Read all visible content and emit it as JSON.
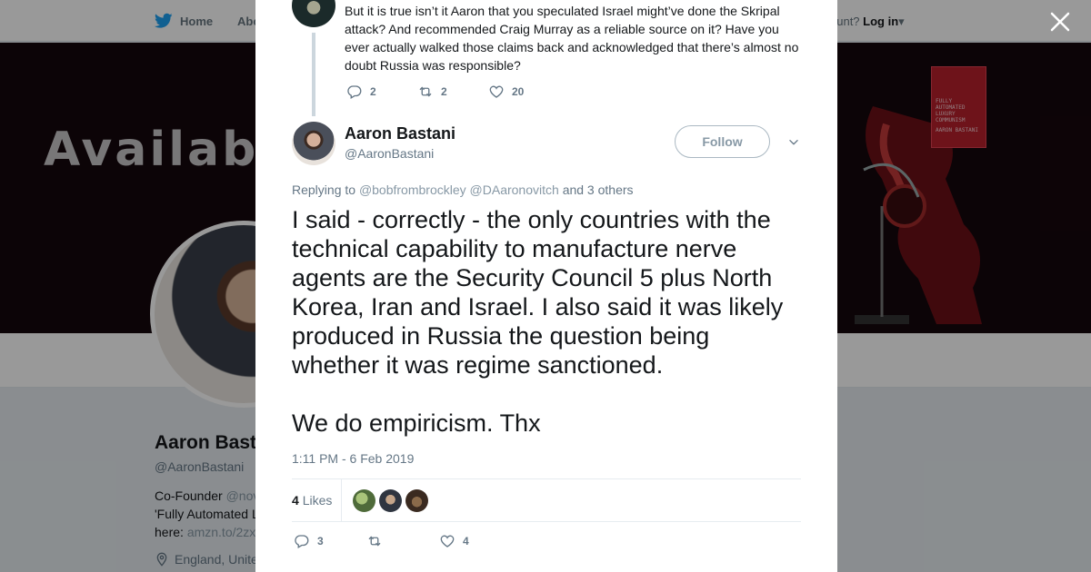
{
  "nav": {
    "home_label": "Home",
    "about_label": "Abo",
    "account_prompt": "ccount?",
    "login_label": "Log in"
  },
  "banner": {
    "text": "Availabl",
    "book_title": "FULLY AUTOMATED LUXURY COMMUNISM",
    "book_author": "AARON BASTANI"
  },
  "profile": {
    "name": "Aaron Bast",
    "handle": "@AaronBastani",
    "bio_line1": "Co-Founder",
    "bio_line1_link": "@nov",
    "bio_line2": "'Fully Automated L",
    "bio_line3": "here:",
    "bio_line3_link": "amzn.to/2zx",
    "location": "England, Unite"
  },
  "parent_tweet": {
    "text": "But it is true isn’t it Aaron that you speculated Israel might’ve done the Skripal attack? And recommended Craig Murray as a reliable source on it? Have you ever actually walked those claims back and acknowledged that there’s almost no doubt Russia was responsible?",
    "replies": "2",
    "retweets": "2",
    "likes": "20"
  },
  "main_tweet": {
    "name": "Aaron Bastani",
    "handle": "@AaronBastani",
    "follow_label": "Follow",
    "replying_prefix": "Replying to",
    "reply_user1": "@bobfrombrockley",
    "reply_user2": "@DAaronovitch",
    "reply_suffix": "and 3 others",
    "text_para1": "I said - correctly - the only countries with the technical capability to manufacture nerve agents are the Security Council 5 plus North Korea, Iran and Israel. I also said it was likely produced in Russia the question being whether it was regime sanctioned.",
    "text_para2": "We do empiricism. Thx",
    "timestamp": "1:11 PM - 6 Feb 2019",
    "likes_count": "4",
    "likes_label": "Likes",
    "replies": "3",
    "retweets": "",
    "likes": "4"
  },
  "colors": {
    "accent": "#1da1f2",
    "muted": "#657786",
    "border": "#e6ecf0",
    "like_red": "#e0245e"
  },
  "icons": {
    "home": "twitter-bird-icon",
    "close": "close-icon",
    "reply": "reply-icon",
    "retweet": "retweet-icon",
    "like": "heart-icon",
    "caret": "chevron-down-icon",
    "location": "location-pin-icon"
  }
}
